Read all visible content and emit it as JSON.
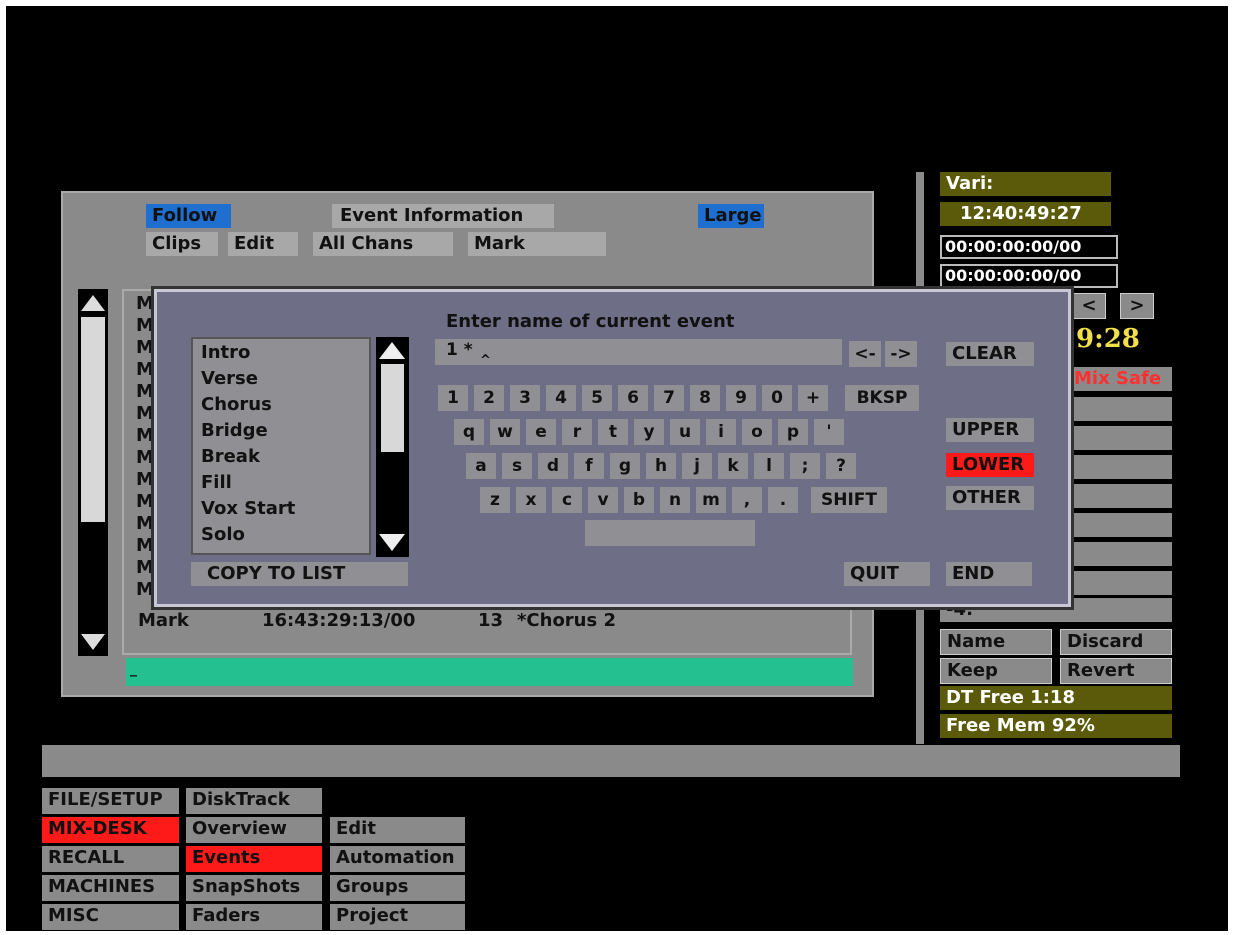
{
  "event_window": {
    "follow": "Follow",
    "event_information": "Event Information",
    "large": "Large",
    "clips": "Clips",
    "edit": "Edit",
    "all_chans": "All Chans",
    "mark": "Mark",
    "row_prefixes": [
      "M",
      "M",
      "M",
      "M",
      "M",
      "M",
      "M",
      "M",
      "M",
      "M",
      "M",
      "M",
      "M",
      "M"
    ],
    "last_row": {
      "type": "Mark",
      "time": "16:43:29:13/00",
      "num": "13",
      "name": "*Chorus 2"
    },
    "input_value": "_"
  },
  "name_dialog": {
    "prompt": "Enter name of current event",
    "input_value": "1  *",
    "caret": "^",
    "left_arrow": "<-",
    "right_arrow": "->",
    "presets": [
      "Intro",
      "Verse",
      "Chorus",
      "Bridge",
      "Break",
      "Fill",
      "Vox  Start",
      "Solo"
    ],
    "copy_to_list": "COPY  TO  LIST",
    "clear": "CLEAR",
    "upper": "UPPER",
    "lower": "LOWER",
    "other": "OTHER",
    "quit": "QUIT",
    "end": "END",
    "keys": {
      "row1": [
        "1",
        "2",
        "3",
        "4",
        "5",
        "6",
        "7",
        "8",
        "9",
        "0",
        "+"
      ],
      "bksp": "BKSP",
      "row2": [
        "q",
        "w",
        "e",
        "r",
        "t",
        "y",
        "u",
        "i",
        "o",
        "p",
        "'"
      ],
      "row3": [
        "a",
        "s",
        "d",
        "f",
        "g",
        "h",
        "j",
        "k",
        "l",
        ";",
        "?"
      ],
      "row4": [
        "z",
        "x",
        "c",
        "v",
        "b",
        "n",
        "m",
        ",",
        "."
      ],
      "shift": "SHIFT",
      "space": ""
    }
  },
  "right_panel": {
    "vari_label": "Vari:",
    "vari_time": "12:40:49:27",
    "tc1": "00:00:00:00/00",
    "tc2": "00:00:00:00/00",
    "nav_prev": "<",
    "nav_next": ">",
    "big_time": "9:28",
    "mix_safe": "Mix Safe",
    "minus4": "-4:",
    "name": "Name",
    "discard": "Discard",
    "keep": "Keep",
    "revert": "Revert",
    "dt_free": "DT  Free  1:18",
    "free_mem": "Free  Mem  92%"
  },
  "menu": {
    "col1": [
      "FILE/SETUP",
      "MIX-DESK",
      "RECALL",
      "MACHINES",
      "MISC"
    ],
    "col2": [
      "DiskTrack",
      "Overview",
      "Events",
      "SnapShots",
      "Faders"
    ],
    "col3": [
      "Edit",
      "Automation",
      "Groups",
      "Project"
    ]
  },
  "colors": {
    "screen_bg": "#000000",
    "panel_gray": "#8a8a8a",
    "dialog_bg": "#6e6e86",
    "highlight_blue": "#1f6fd0",
    "active_red": "#ff1a1a",
    "input_green": "#25c08f",
    "olive": "#5a5a0a",
    "yellow_text": "#f2e04a"
  }
}
